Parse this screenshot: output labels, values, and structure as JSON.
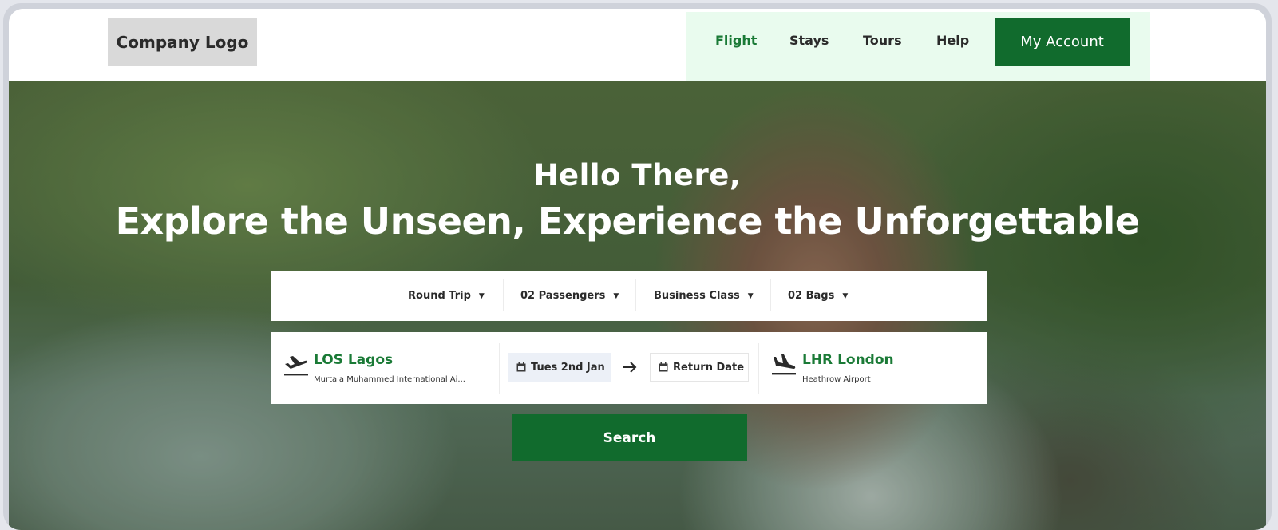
{
  "header": {
    "logo_text": "Company Logo",
    "nav": [
      {
        "label": "Flight",
        "active": true
      },
      {
        "label": "Stays",
        "active": false
      },
      {
        "label": "Tours",
        "active": false
      },
      {
        "label": "Help",
        "active": false
      }
    ],
    "account_label": "My Account"
  },
  "hero": {
    "greeting": "Hello There,",
    "headline": "Explore the Unseen, Experience the Unforgettable"
  },
  "search": {
    "options": [
      {
        "label": "Round Trip",
        "icon": "caret-down-icon"
      },
      {
        "label": "02 Passengers",
        "icon": "caret-down-icon"
      },
      {
        "label": "Business Class",
        "icon": "caret-down-icon"
      },
      {
        "label": "02 Bags",
        "icon": "caret-down-icon"
      }
    ],
    "origin": {
      "code_city": "LOS Lagos",
      "airport": "Murtala Muhammed International Ai...",
      "icon": "plane-departure-icon"
    },
    "depart_date": "Tues 2nd Jan",
    "return_date": "Return Date",
    "destination": {
      "code_city": "LHR London",
      "airport": "Heathrow Airport",
      "icon": "plane-arrival-icon"
    },
    "search_label": "Search"
  },
  "colors": {
    "brand_green": "#116b2d",
    "active_nav": "#1a7a36",
    "nav_background": "#e9fbee"
  }
}
